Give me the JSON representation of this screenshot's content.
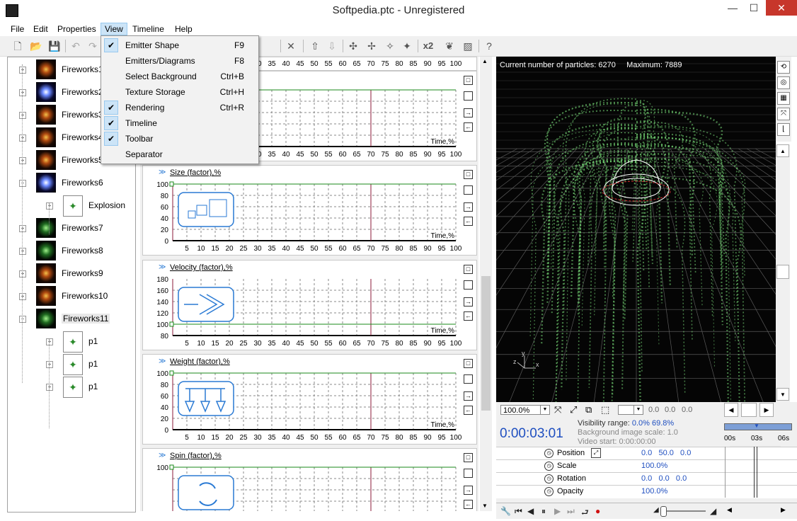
{
  "window": {
    "title": "Softpedia.ptc - Unregistered",
    "minimize": "—",
    "maximize": "☐",
    "close": "✕"
  },
  "menubar": [
    "File",
    "Edit",
    "Properties",
    "View",
    "Timeline",
    "Help"
  ],
  "view_menu": [
    {
      "label": "Emitter Shape",
      "shortcut": "F9",
      "checked": true
    },
    {
      "label": "Emitters/Diagrams",
      "shortcut": "F8",
      "checked": false
    },
    {
      "label": "Select Background",
      "shortcut": "Ctrl+B",
      "checked": false
    },
    {
      "label": "Texture Storage",
      "shortcut": "Ctrl+H",
      "checked": false
    },
    {
      "label": "Rendering",
      "shortcut": "Ctrl+R",
      "checked": true
    },
    {
      "label": "Timeline",
      "shortcut": "",
      "checked": true
    },
    {
      "label": "Toolbar",
      "shortcut": "",
      "checked": true
    },
    {
      "label": "Separator",
      "shortcut": "",
      "checked": false
    }
  ],
  "toolbar": {
    "icons": [
      "new-file-icon",
      "open-folder-icon",
      "save-icon",
      "undo-icon",
      "redo-icon",
      "delete-icon",
      "move-up-icon",
      "move-down-icon",
      "emitter-shape-icon",
      "emitter-shape-2-icon",
      "emitter-shape-3-icon",
      "emitter-shape-4-icon",
      "times-two-icon",
      "leaf-icon",
      "picture-icon",
      "help-icon"
    ],
    "x2_label": "x2"
  },
  "tree": {
    "items": [
      {
        "label": "Fireworks1",
        "thumb": "orange"
      },
      {
        "label": "Fireworks2",
        "thumb": "blue"
      },
      {
        "label": "Fireworks3",
        "thumb": "orange"
      },
      {
        "label": "Fireworks4",
        "thumb": "orange"
      },
      {
        "label": "Fireworks5",
        "thumb": "orange"
      },
      {
        "label": "Fireworks6",
        "thumb": "blue"
      },
      {
        "label": "Explosion",
        "thumb": "emitter"
      },
      {
        "label": "Fireworks7",
        "thumb": "green"
      },
      {
        "label": "Fireworks8",
        "thumb": "green"
      },
      {
        "label": "Fireworks9",
        "thumb": "orange"
      },
      {
        "label": "Fireworks10",
        "thumb": "orange"
      },
      {
        "label": "Fireworks11",
        "thumb": "green"
      },
      {
        "label": "p1",
        "thumb": "emitter"
      },
      {
        "label": "p1",
        "thumb": "emitter"
      },
      {
        "label": "p1",
        "thumb": "emitter"
      }
    ]
  },
  "graphs": {
    "x_ticks": [
      "5",
      "10",
      "15",
      "20",
      "25",
      "30",
      "35",
      "40",
      "45",
      "50",
      "55",
      "60",
      "65",
      "70",
      "75",
      "80",
      "85",
      "90",
      "95",
      "100"
    ],
    "x_axis_label": "Time,%",
    "cards": [
      {
        "title": "",
        "y_ticks": []
      },
      {
        "title": "Size (factor),%",
        "y_ticks": [
          "100",
          "80",
          "60",
          "40",
          "20",
          "0"
        ],
        "level_fraction": 1.0
      },
      {
        "title": "Velocity (factor),%",
        "y_ticks": [
          "180",
          "160",
          "140",
          "120",
          "100",
          "80"
        ],
        "level_fraction": 0.2
      },
      {
        "title": "Weight (factor),%",
        "y_ticks": [
          "100",
          "80",
          "60",
          "40",
          "20",
          "0"
        ],
        "level_fraction": 1.0
      },
      {
        "title": "Spin (factor),%",
        "y_ticks": [
          "100"
        ],
        "level_fraction": 1.0
      }
    ],
    "marker_percent": 70
  },
  "viewport": {
    "particles_label": "Current number of particles:",
    "particles_value": "6270",
    "maximum_label": "Maximum:",
    "maximum_value": "7889",
    "axis_y": "y",
    "axis_x": "x",
    "axis_z": "z"
  },
  "vp_bar": {
    "zoom": "100.0%",
    "v1": "0.0",
    "v2": "0.0",
    "v3": "0.0"
  },
  "timeline": {
    "time": "0:00:03:01",
    "visibility_label": "Visibility range:",
    "visibility_from": "0.0%",
    "visibility_to": "69.8%",
    "bg_scale_label": "Background image scale:",
    "bg_scale_value": "1.0",
    "video_start_label": "Video start:",
    "video_start_value": "0:00:00:00",
    "ruler_labels": [
      "00s",
      "03s",
      "06s"
    ],
    "tracks": [
      {
        "name": "Position",
        "values": "0.0   50.0   0.0"
      },
      {
        "name": "Scale",
        "values": "100.0%"
      },
      {
        "name": "Rotation",
        "values": "0.0   0.0   0.0"
      },
      {
        "name": "Opacity",
        "values": "100.0%"
      }
    ]
  }
}
